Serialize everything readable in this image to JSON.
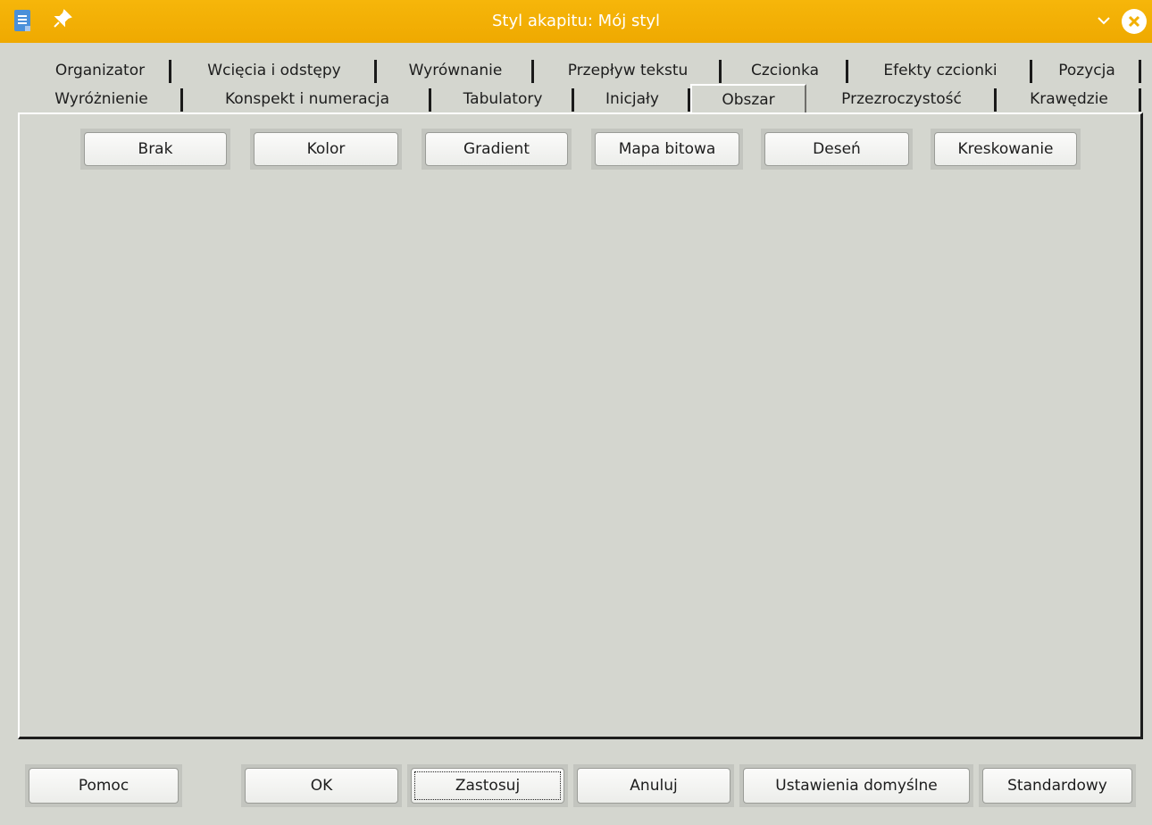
{
  "window": {
    "title": "Styl akapitu: Mój styl",
    "icons": [
      "writer-document-icon",
      "pin-icon",
      "chevron-down-icon",
      "close-icon"
    ],
    "accent_color": "#f2b000"
  },
  "tabs": {
    "row1": [
      "Organizator",
      "Wcięcia i odstępy",
      "Wyrównanie",
      "Przepływ tekstu",
      "Czcionka",
      "Efekty czcionki",
      "Pozycja"
    ],
    "row2": [
      "Wyróżnienie",
      "Konspekt i numeracja",
      "Tabulatory",
      "Inicjały",
      "Obszar",
      "Przezroczystość",
      "Krawędzie"
    ],
    "active": "Obszar"
  },
  "area": {
    "buttons": [
      "Brak",
      "Kolor",
      "Gradient",
      "Mapa bitowa",
      "Deseń",
      "Kreskowanie"
    ]
  },
  "footer": {
    "help": "Pomoc",
    "ok": "OK",
    "apply": "Zastosuj",
    "cancel": "Anuluj",
    "defaults": "Ustawienia domyślne",
    "standard": "Standardowy"
  }
}
